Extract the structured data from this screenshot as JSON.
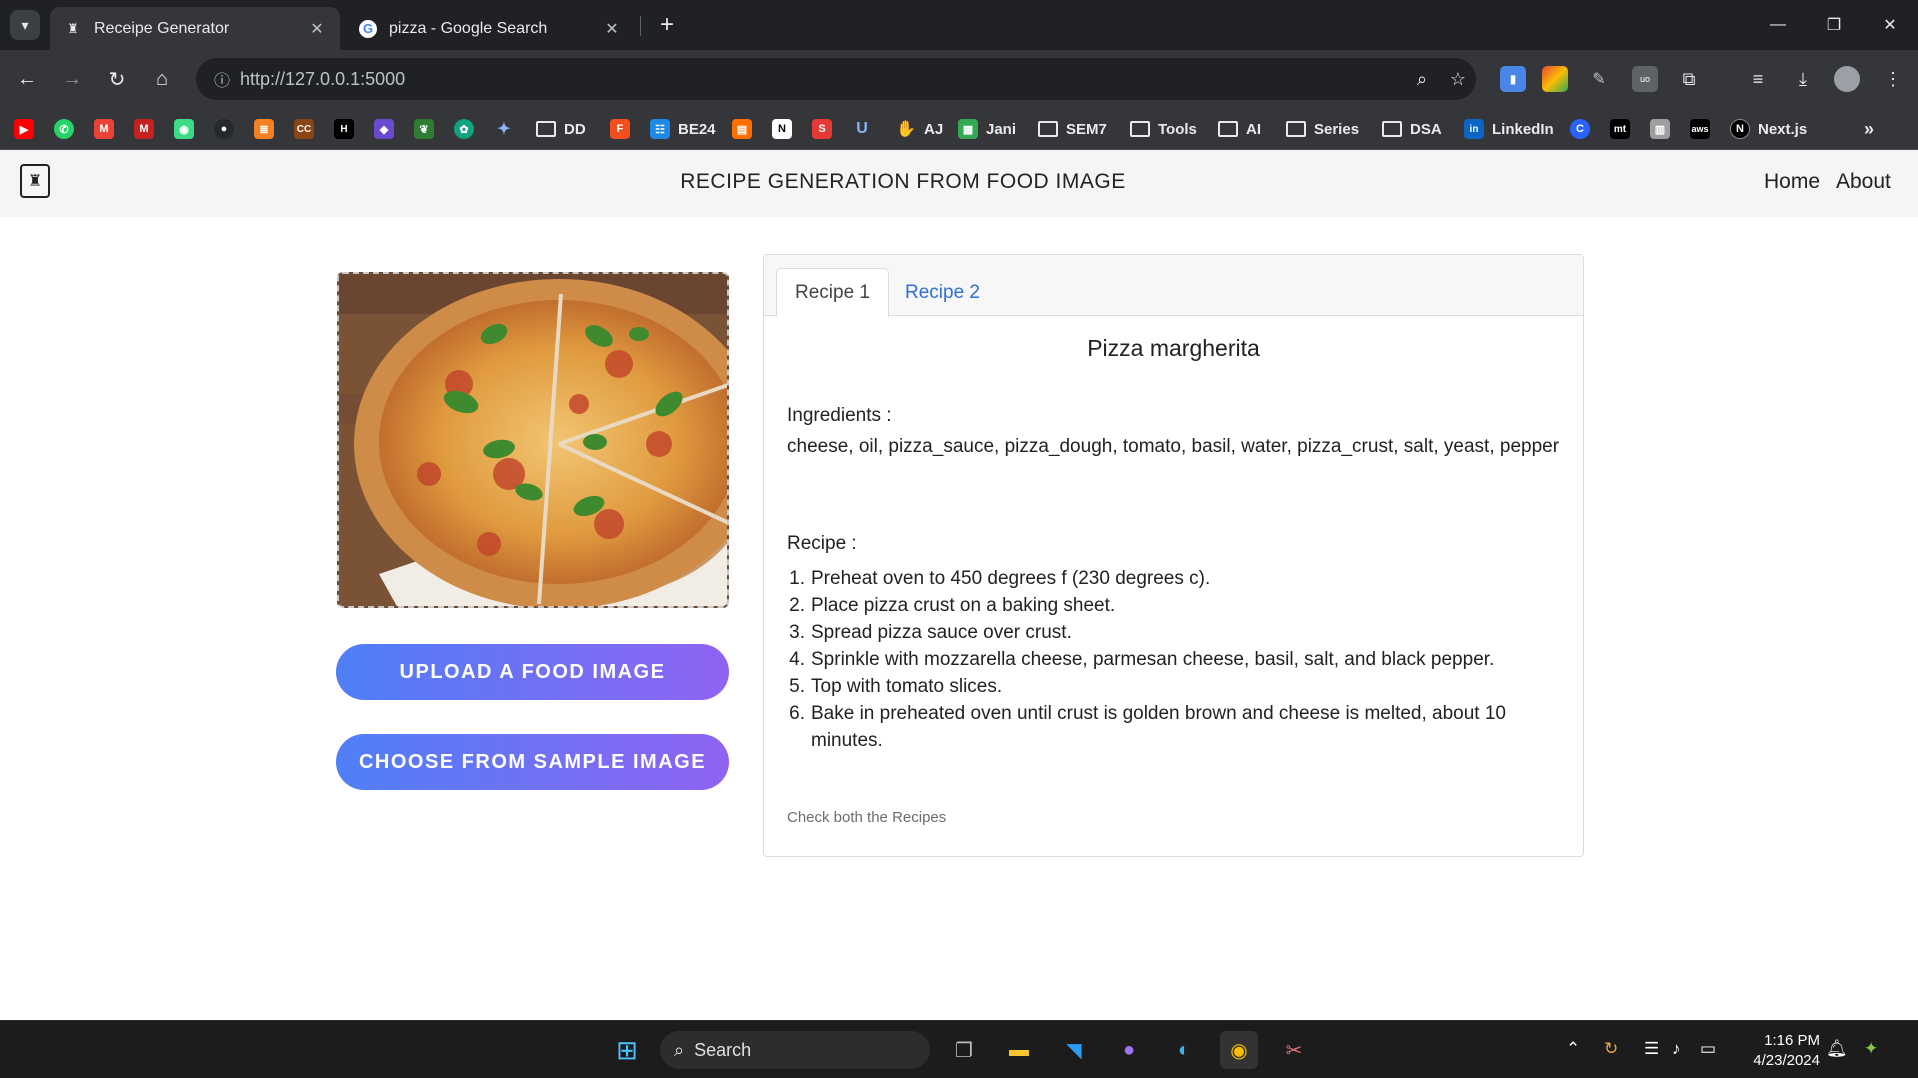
{
  "browser": {
    "tabs": [
      {
        "title": "Receipe Generator",
        "active": true
      },
      {
        "title": "pizza - Google Search",
        "active": false
      }
    ],
    "url": "http://127.0.0.1:5000",
    "bookmarks": [
      {
        "label": "DD",
        "type": "folder"
      },
      {
        "label": "BE24",
        "type": "link"
      },
      {
        "label": "AJ",
        "type": "link"
      },
      {
        "label": "Jani",
        "type": "link"
      },
      {
        "label": "SEM7",
        "type": "folder"
      },
      {
        "label": "Tools",
        "type": "folder"
      },
      {
        "label": "AI",
        "type": "folder"
      },
      {
        "label": "Series",
        "type": "folder"
      },
      {
        "label": "DSA",
        "type": "folder"
      },
      {
        "label": "LinkedIn",
        "type": "link"
      },
      {
        "label": "Next.js",
        "type": "link"
      }
    ]
  },
  "navbar": {
    "title": "RECIPE GENERATION FROM FOOD IMAGE",
    "links": [
      "Home",
      "About"
    ]
  },
  "upload": {
    "upload_label": "UPLOAD A FOOD IMAGE",
    "sample_label": "CHOOSE FROM SAMPLE IMAGE"
  },
  "recipe_card": {
    "tabs": [
      "Recipe 1",
      "Recipe 2"
    ],
    "active_tab": "Recipe 1",
    "dish_name": "Pizza margherita",
    "ingredients_label": "Ingredients :",
    "ingredients": "cheese, oil, pizza_sauce, pizza_dough, tomato, basil, water, pizza_crust, salt, yeast, pepper",
    "recipe_label": "Recipe :",
    "steps": [
      {
        "num": "1.",
        "text": "Preheat oven to 450 degrees f (230 degrees c)."
      },
      {
        "num": "2.",
        "text": "Place pizza crust on a baking sheet."
      },
      {
        "num": "3.",
        "text": "Spread pizza sauce over crust."
      },
      {
        "num": "4.",
        "text": "Sprinkle with mozzarella cheese, parmesan cheese, basil, salt, and black pepper."
      },
      {
        "num": "5.",
        "text": "Top with tomato slices."
      },
      {
        "num": "6.",
        "text": "Bake in preheated oven until crust is golden brown and cheese is melted, about 10 minutes."
      }
    ],
    "footnote": "Check both the Recipes"
  },
  "taskbar": {
    "search_placeholder": "Search",
    "time": "1:16 PM",
    "date": "4/23/2024"
  },
  "colors": {
    "button_gradient_start": "#4f7ff7",
    "button_gradient_end": "#8f63f2",
    "tab_link": "#2f6fd6"
  }
}
